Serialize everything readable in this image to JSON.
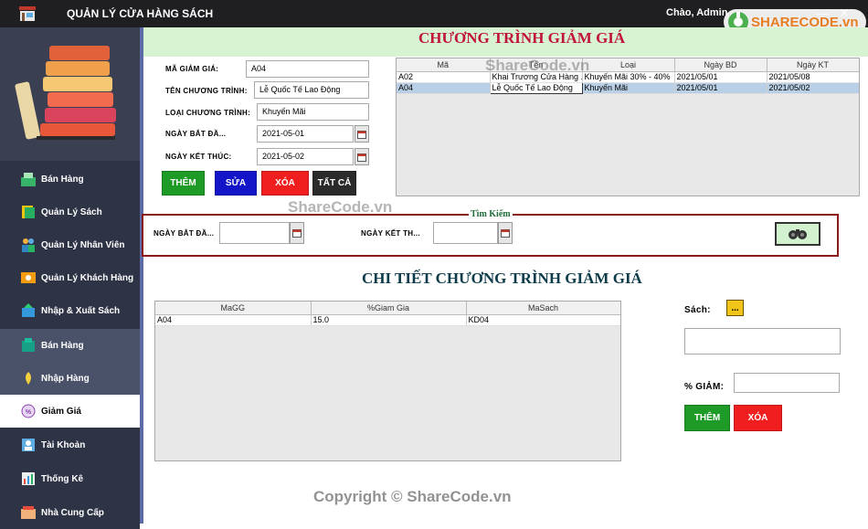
{
  "window": {
    "title": "QUẢN LÝ CỬA HÀNG SÁCH",
    "greeting": "Chào, Admin"
  },
  "brand": {
    "logo_text": "SHARECODE.vn"
  },
  "sidebar": {
    "items": [
      {
        "label": "Bán Hàng",
        "icon": "cashier-icon"
      },
      {
        "label": "Quản Lý Sách",
        "icon": "book-icon"
      },
      {
        "label": "Quản Lý Nhân Viên",
        "icon": "staff-icon"
      },
      {
        "label": "Quản Lý Khách Hàng",
        "icon": "customer-icon"
      },
      {
        "label": "Nhập & Xuất Sách",
        "icon": "import-export-icon"
      },
      {
        "label": "Bán Hàng",
        "icon": "sales-icon"
      },
      {
        "label": "Nhập Hàng",
        "icon": "receive-goods-icon"
      },
      {
        "label": "Giảm Giá",
        "icon": "discount-icon"
      },
      {
        "label": "Tài Khoản",
        "icon": "account-icon"
      },
      {
        "label": "Thống Kê",
        "icon": "statistics-icon"
      },
      {
        "label": "Nhà Cung Cấp",
        "icon": "supplier-icon"
      }
    ]
  },
  "page": {
    "title": "CHƯƠNG TRÌNH GIẢM GIÁ"
  },
  "form": {
    "code_label": "MÃ GIẢM GIÁ:",
    "code_value": "A04",
    "name_label": "TÊN CHƯƠNG TRÌNH:",
    "name_value": "Lễ Quốc Tế Lao Động",
    "type_label": "LOẠI CHƯƠNG TRÌNH:",
    "type_value": "Khuyến Mãi",
    "start_label": "NGÀY BẮT ĐẦ...",
    "start_value": "2021-05-01",
    "end_label": "NGÀY KẾT THÚC:",
    "end_value": "2021-05-02"
  },
  "buttons": {
    "add": "THÊM",
    "edit": "SỬA",
    "delete": "XÓA",
    "all": "TẤT CẢ"
  },
  "programs_table": {
    "headers": [
      "Mã",
      "Tên",
      "Loại",
      "Ngày BD",
      "Ngày KT"
    ],
    "rows": [
      [
        "A02",
        "Khai Trương Cửa Hàng ...",
        "Khuyến Mãi 30% - 40%",
        "2021/05/01",
        "2021/05/08"
      ],
      [
        "A04",
        "Lễ Quốc Tế Lao Động",
        "Khuyến Mãi",
        "2021/05/01",
        "2021/05/02"
      ]
    ],
    "selected_row": 1
  },
  "search": {
    "legend": "Tìm Kiếm",
    "start_label": "NGÀY BẮT ĐẦ...",
    "end_label": "NGÀY KẾT TH..."
  },
  "detail": {
    "title": "CHI TIẾT CHƯƠNG TRÌNH GIẢM GIÁ",
    "headers": [
      "MaGG",
      "%Giam Gia",
      "MaSach"
    ],
    "rows": [
      [
        "A04",
        "15.0",
        "KD04"
      ]
    ],
    "book_label": "Sách:",
    "book_button": "...",
    "percent_label": "% GIẢM:",
    "add_button": "THÊM",
    "delete_button": "XÓA"
  },
  "watermarks": {
    "top": "ShareCode.vn",
    "middle": "ShareCode.vn",
    "bottom": "Copyright © ShareCode.vn"
  },
  "colors": {
    "add": "#1e9b26",
    "edit": "#1414c8",
    "delete": "#f01e1e",
    "all": "#2b2b2b",
    "title_red": "#c0143c"
  }
}
